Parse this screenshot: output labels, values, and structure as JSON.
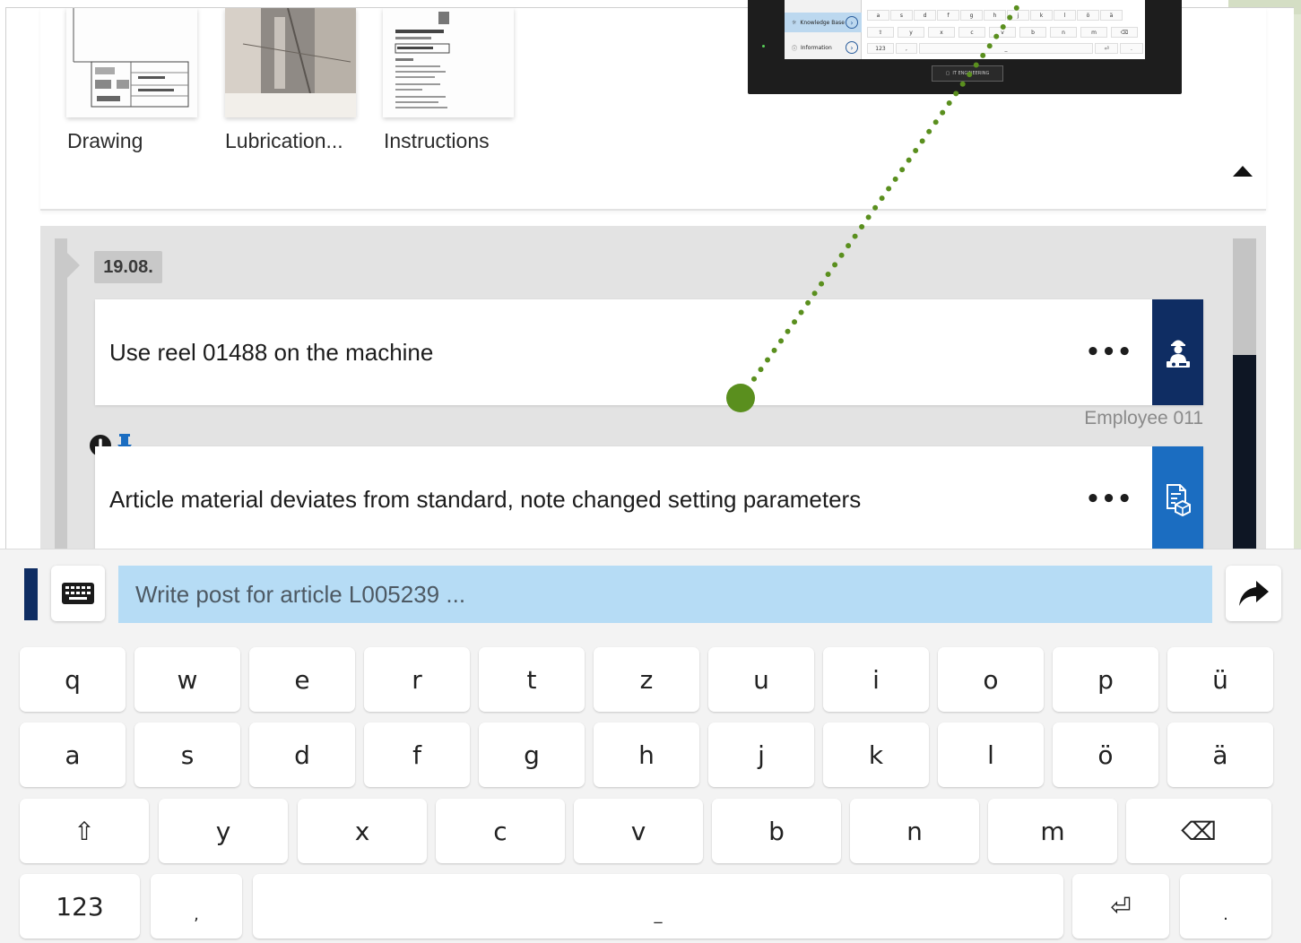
{
  "attachments": {
    "items": [
      {
        "label": "Drawing",
        "icon": "drawing-thumbnail"
      },
      {
        "label": "Lubrication...",
        "icon": "photo-thumbnail"
      },
      {
        "label": "Instructions",
        "icon": "document-thumbnail"
      }
    ],
    "collapse_icon": "triangle-up-icon"
  },
  "timeline": {
    "date": "19.08.",
    "posts": [
      {
        "text": "Use reel 01488 on the machine",
        "more": "•••",
        "author": "Employee 011",
        "avatar_icon": "worker-icon",
        "side_color": "#0f2d63"
      },
      {
        "text": "Article material deviates from standard, note changed setting parameters",
        "more": "•••",
        "flags": [
          "important-icon",
          "pin-icon"
        ],
        "avatar_icon": "article-document-icon",
        "side_color": "#1b6dc1"
      }
    ]
  },
  "input": {
    "placeholder": "Write post for article L005239 ...",
    "keyboard_icon": "keyboard-icon",
    "send_icon": "send-arrow-icon"
  },
  "keyboard": {
    "row1": [
      "q",
      "w",
      "e",
      "r",
      "t",
      "z",
      "u",
      "i",
      "o",
      "p",
      "ü"
    ],
    "row2": [
      "a",
      "s",
      "d",
      "f",
      "g",
      "h",
      "j",
      "k",
      "l",
      "ö",
      "ä"
    ],
    "row3": [
      "⇧",
      "y",
      "x",
      "c",
      "v",
      "b",
      "n",
      "m",
      "⌫"
    ],
    "row4": [
      "123",
      ",",
      "_",
      "⏎",
      "."
    ]
  },
  "device": {
    "menu": [
      {
        "label": "Knowledge Base",
        "active": true
      },
      {
        "label": "Information",
        "active": false
      }
    ],
    "keys_row_a": [
      "a",
      "s",
      "d",
      "f",
      "g",
      "h",
      "j",
      "k",
      "l",
      "ö",
      "ä"
    ],
    "keys_row_b": [
      "⇧",
      "y",
      "x",
      "c",
      "v",
      "b",
      "n",
      "m",
      "⌫"
    ],
    "keys_row_c": [
      "123",
      ",",
      "_",
      "⏎",
      "."
    ],
    "logo_text": "IT ENGINEERING",
    "connector_color": "#5a8f1e"
  },
  "colors": {
    "accent_dark": "#0f2d63",
    "accent_blue": "#1b6dc1",
    "input_bg": "#b6dcf5"
  }
}
